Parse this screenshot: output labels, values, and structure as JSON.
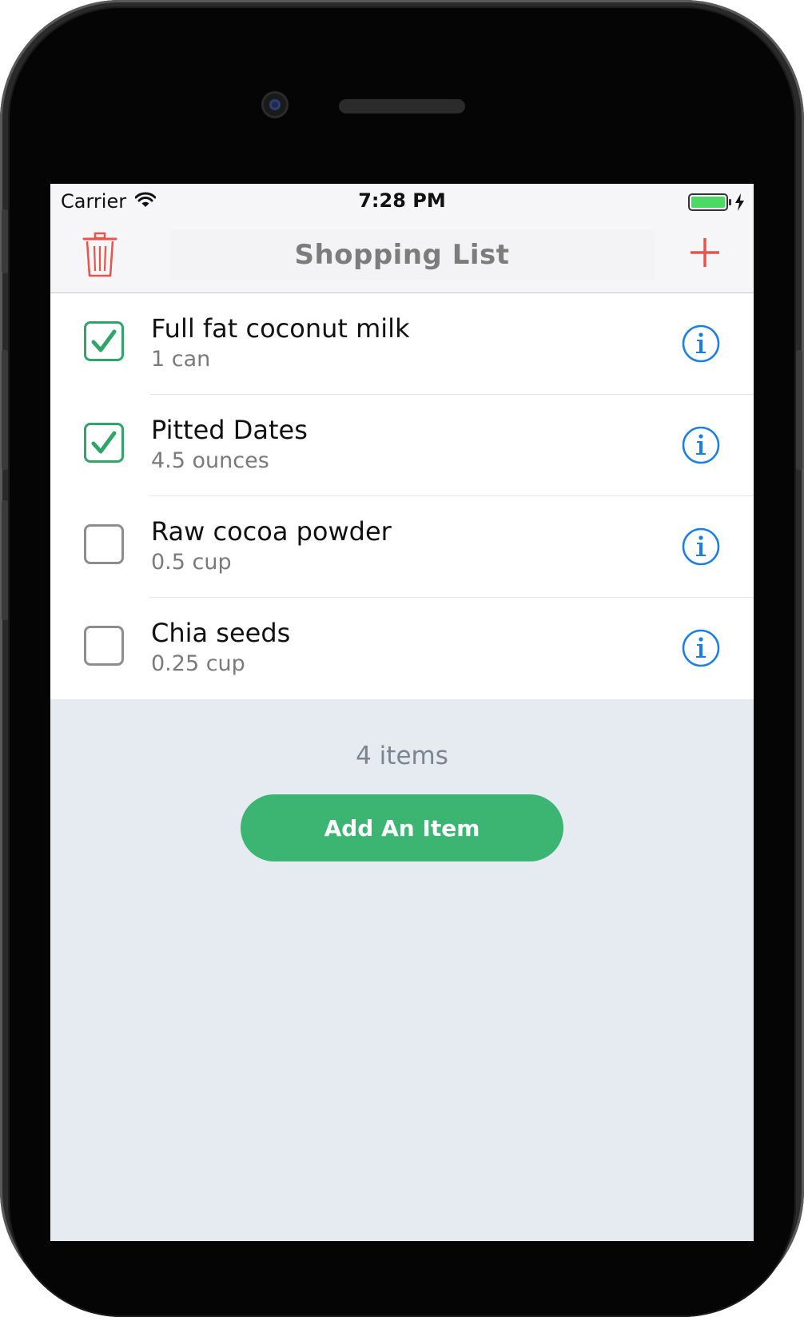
{
  "status_bar": {
    "carrier": "Carrier",
    "time": "7:28 PM",
    "battery_icon": "battery-charging-icon",
    "wifi_icon": "wifi-icon"
  },
  "nav": {
    "title": "Shopping List",
    "left_icon": "trash-icon",
    "right_icon": "plus-icon"
  },
  "items": [
    {
      "name": "Full fat coconut milk",
      "quantity": "1 can",
      "checked": true
    },
    {
      "name": "Pitted Dates",
      "quantity": "4.5 ounces",
      "checked": true
    },
    {
      "name": "Raw cocoa powder",
      "quantity": "0.5 cup",
      "checked": false
    },
    {
      "name": "Chia seeds",
      "quantity": "0.25 cup",
      "checked": false
    }
  ],
  "footer": {
    "count_text": "4 items",
    "add_button_label": "Add An Item"
  },
  "colors": {
    "accent_green": "#3cb572",
    "check_green": "#2fa56a",
    "danger_red": "#e8534a",
    "info_blue": "#1a7ee6"
  }
}
